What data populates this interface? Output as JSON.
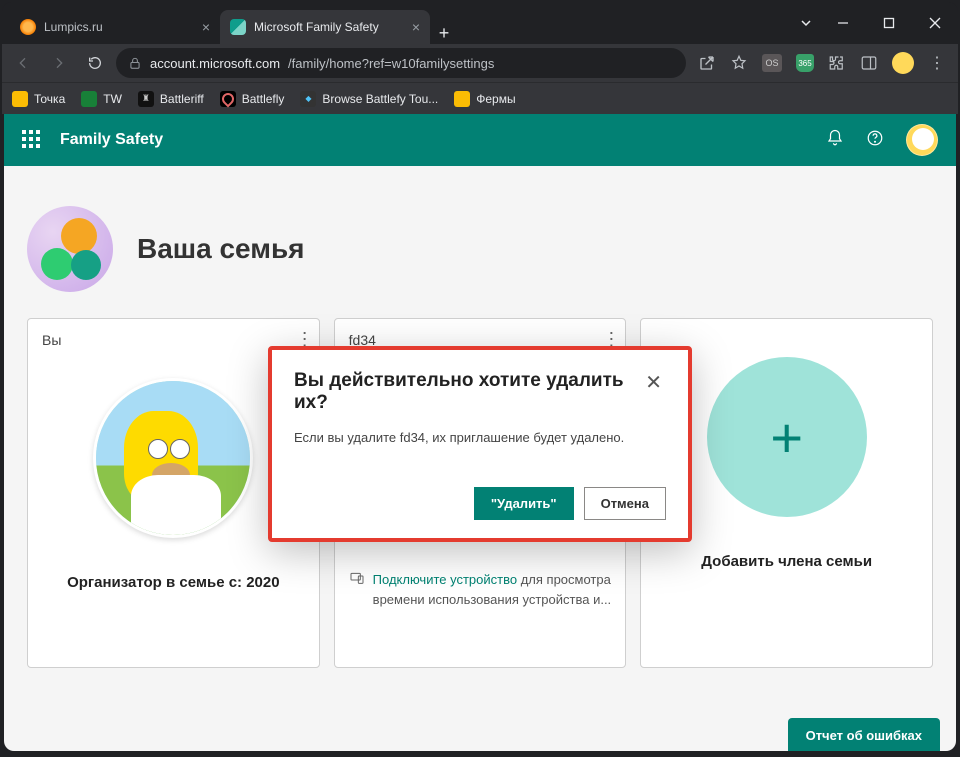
{
  "browser": {
    "tabs": [
      {
        "title": "Lumpics.ru"
      },
      {
        "title": "Microsoft Family Safety"
      }
    ],
    "url": {
      "domain": "account.microsoft.com",
      "path": "/family/home?ref=w10familysettings"
    },
    "ext_badge": "365",
    "bookmarks": [
      {
        "label": "Точка"
      },
      {
        "label": "TW"
      },
      {
        "label": "Battleriff"
      },
      {
        "label": "Battlefly"
      },
      {
        "label": "Browse Battlefy Tou..."
      },
      {
        "label": "Фермы"
      }
    ]
  },
  "app_header": {
    "title": "Family Safety"
  },
  "family": {
    "title": "Ваша семья"
  },
  "cards": {
    "you": {
      "head": "Вы",
      "org": "Организатор в семье с: 2020"
    },
    "member": {
      "head": "fd34",
      "link": "Подключите устройство",
      "rest": " для просмотра времени использования устройства и..."
    },
    "add": {
      "label": "Добавить члена семьи"
    }
  },
  "feedback": {
    "label": "Отчет об ошибках"
  },
  "modal": {
    "title": "Вы действительно хотите удалить их?",
    "body": "Если вы удалите fd34, их приглашение будет удалено.",
    "primary": "\"Удалить\"",
    "secondary": "Отмена"
  }
}
